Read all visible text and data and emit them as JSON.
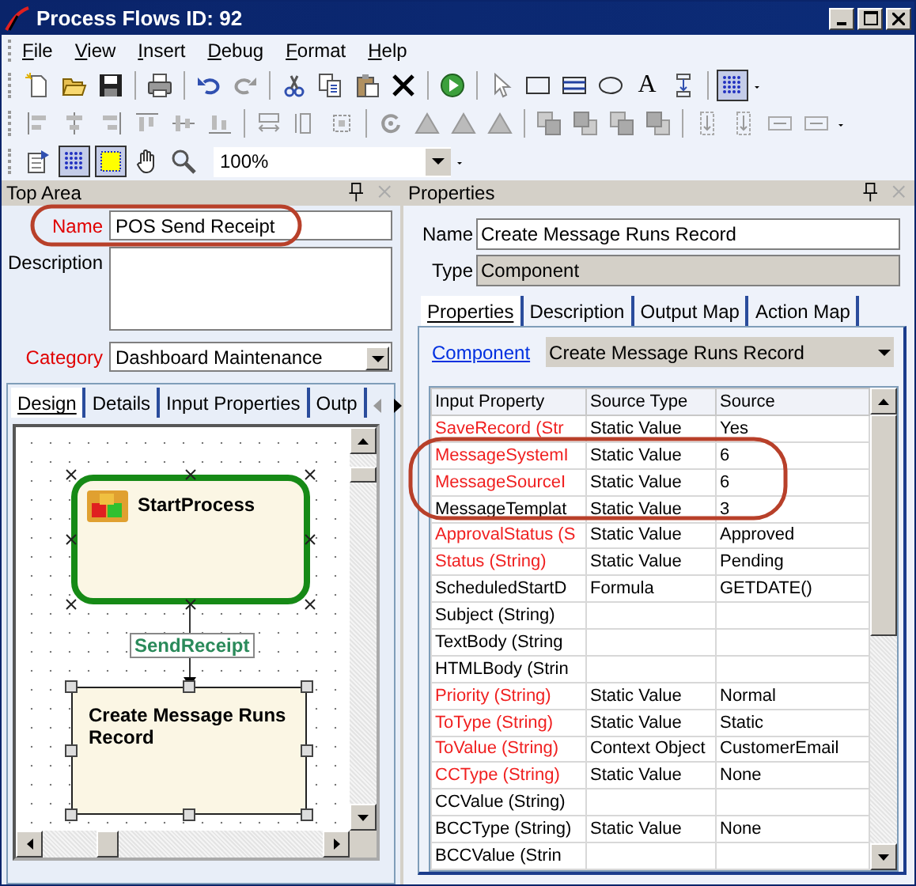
{
  "window": {
    "title": "Process Flows ID: 92"
  },
  "menu": [
    {
      "label": "File"
    },
    {
      "label": "View"
    },
    {
      "label": "Insert"
    },
    {
      "label": "Debug"
    },
    {
      "label": "Format"
    },
    {
      "label": "Help"
    }
  ],
  "toolbar": {
    "text_tool": "A",
    "grid_pressed": true,
    "zoom": "100%",
    "view_toggles": [
      {
        "pressed": true
      },
      {
        "pressed": true
      }
    ]
  },
  "top_area": {
    "title": "Top Area",
    "fields": [
      {
        "kind": "text",
        "label": "Name",
        "value": "POS Send Receipt",
        "required": true,
        "circled": true
      },
      {
        "kind": "textarea",
        "label": "Description",
        "required": false,
        "circled": false
      },
      {
        "kind": "dropdown",
        "label": "Category",
        "value": "Dashboard Maintenance",
        "required": true,
        "circled": false
      }
    ],
    "tabs": [
      {
        "label": "Design",
        "selected": true
      },
      {
        "label": "Details",
        "selected": false
      },
      {
        "label": "Input Properties",
        "selected": false
      },
      {
        "label": "Outp",
        "selected": false
      }
    ],
    "diagram": {
      "nodes": [
        {
          "kind": "start",
          "label": "StartProcess",
          "selected": false
        },
        {
          "kind": "component",
          "label": "Create Message Runs Record",
          "selected": true
        }
      ],
      "connector": {
        "label": "SendReceipt"
      }
    }
  },
  "properties": {
    "title": "Properties",
    "name_label": "Name",
    "name": "Create Message Runs Record",
    "type_label": "Type",
    "type": "Component",
    "tabs": [
      {
        "label": "Properties",
        "selected": true
      },
      {
        "label": "Description",
        "selected": false
      },
      {
        "label": "Output Map",
        "selected": false
      },
      {
        "label": "Action Map",
        "selected": false
      }
    ],
    "component_label": "Component",
    "component": "Create Message Runs Record",
    "columns": [
      "Input Property",
      "Source Type",
      "Source"
    ],
    "rows": [
      {
        "property": "SaveRecord (Str",
        "source_type": "Static Value",
        "source": "Yes",
        "required": true,
        "circled": false
      },
      {
        "property": "MessageSystemI",
        "source_type": "Static Value",
        "source": "6",
        "required": true,
        "circled": true
      },
      {
        "property": "MessageSourceI",
        "source_type": "Static Value",
        "source": "6",
        "required": true,
        "circled": true
      },
      {
        "property": "MessageTemplat",
        "source_type": "Static Value",
        "source": "3",
        "required": false,
        "circled": true
      },
      {
        "property": "ApprovalStatus (S",
        "source_type": "Static Value",
        "source": "Approved",
        "required": true,
        "circled": false
      },
      {
        "property": "Status (String)",
        "source_type": "Static Value",
        "source": "Pending",
        "required": true,
        "circled": false
      },
      {
        "property": "ScheduledStartD",
        "source_type": "Formula",
        "source": "GETDATE()",
        "required": false,
        "circled": false
      },
      {
        "property": "Subject (String)",
        "required": false,
        "circled": false
      },
      {
        "property": "TextBody (String",
        "required": false,
        "circled": false
      },
      {
        "property": "HTMLBody (Strin",
        "required": false,
        "circled": false
      },
      {
        "property": "Priority (String)",
        "source_type": "Static Value",
        "source": "Normal",
        "required": true,
        "circled": false
      },
      {
        "property": "ToType (String)",
        "source_type": "Static Value",
        "source": "Static",
        "required": true,
        "circled": false
      },
      {
        "property": "ToValue (String)",
        "source_type": "Context Object",
        "source": "CustomerEmail",
        "required": true,
        "circled": false
      },
      {
        "property": "CCType (String)",
        "source_type": "Static Value",
        "source": "None",
        "required": true,
        "circled": false
      },
      {
        "property": "CCValue (String)",
        "required": false,
        "circled": false
      },
      {
        "property": "BCCType (String)",
        "source_type": "Static Value",
        "source": "None",
        "required": false,
        "circled": false
      },
      {
        "property": "BCCValue (Strin",
        "required": false,
        "circled": false
      }
    ]
  }
}
